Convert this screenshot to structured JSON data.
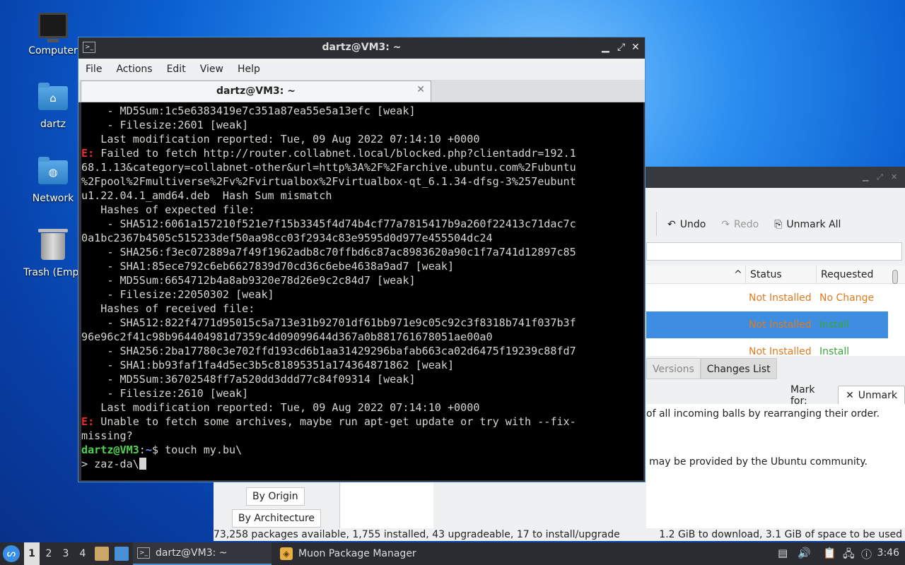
{
  "desktop": {
    "icons": [
      {
        "label": "Computer",
        "icon": "monitor-icon"
      },
      {
        "label": "dartz",
        "icon": "home-folder-icon"
      },
      {
        "label": "Network",
        "icon": "network-folder-icon"
      },
      {
        "label": "Trash (Empt",
        "icon": "trash-icon"
      }
    ]
  },
  "terminal": {
    "window_title": "dartz@VM3: ~",
    "menu": [
      "File",
      "Actions",
      "Edit",
      "View",
      "Help"
    ],
    "tab_label": "dartz@VM3: ~",
    "lines": [
      "    - MD5Sum:1c5e6383419e7c351a87ea55e5a13efc [weak]",
      "    - Filesize:2601 [weak]",
      "   Last modification reported: Tue, 09 Aug 2022 07:14:10 +0000",
      " Failed to fetch http://router.collabnet.local/blocked.php?clientaddr=192.1",
      "68.1.13&category=collabnet-other&url=http%3A%2F%2Farchive.ubuntu.com%2Fubuntu",
      "%2Fpool%2Fmultiverse%2Fv%2Fvirtualbox%2Fvirtualbox-qt_6.1.34-dfsg-3%257eubunt",
      "u1.22.04.1_amd64.deb  Hash Sum mismatch",
      "   Hashes of expected file:",
      "    - SHA512:6061a157210f521e7f15b3345f4d74b4cf77a7815417b9a260f22413c71dac7c",
      "0a1bc2367b4505c515233def50aa98cc03f2934c83e9595d0d977e455504dc24",
      "    - SHA256:f3ec072889a7f49f1962adb8c70ffbd6c87ac8983620a90c1f7a741d12897c85",
      "    - SHA1:85ece792c6eb6627839d70cd36c6ebe4638a9ad7 [weak]",
      "    - MD5Sum:6654712b4a8ab9320e78d26e9c2c84d7 [weak]",
      "    - Filesize:22050302 [weak]",
      "   Hashes of received file:",
      "    - SHA512:822f4771d95015c5a713e31b92701df61bb971e9c05c92c3f8318b741f037b3f",
      "96e96c2f41c98b964404981d7359c4d09099644d367a0b881761678051ae00a0",
      "    - SHA256:2ba17780c3e702ffd193cd6b1aa31429296bafab663ca02d6475f19239c88fd7",
      "    - SHA1:bb93faf1fa4d5ec3b5c81895351a174364871862 [weak]",
      "    - MD5Sum:36702548ff7a520dd3ddd77c84f09314 [weak]",
      "    - Filesize:2610 [weak]",
      "   Last modification reported: Tue, 09 Aug 2022 07:14:10 +0000",
      " Unable to fetch some archives, maybe run apt-get update or try with --fix-",
      "missing?"
    ],
    "error_prefix": "E:",
    "prompt_user": "dartz@VM3",
    "prompt_sep": ":",
    "prompt_path": "~",
    "prompt_dollar": "$",
    "command": " touch my.bu\\",
    "continuation": "> zaz-da\\"
  },
  "muon": {
    "toolbar": {
      "undo": "Undo",
      "redo": "Redo",
      "unmark_all": "Unmark All"
    },
    "columns": [
      "Status",
      "Requested"
    ],
    "rows": [
      {
        "status": "Not Installed",
        "requested": "No Change"
      },
      {
        "status": "Not Installed",
        "requested": "Install"
      },
      {
        "status": "Not Installed",
        "requested": "Install"
      }
    ],
    "tabs": [
      "Versions",
      "Changes List"
    ],
    "mark_for_label": "Mark for:",
    "unmark_button": "Unmark",
    "desc_line1": "of all incoming balls by rearranging their order.",
    "desc_line2": "may be provided by the Ubuntu community.",
    "filter_buttons": [
      "By Origin",
      "By Architecture"
    ],
    "status_left": "73,258 packages available, 1,755 installed, 43 upgradeable, 17 to install/upgrade",
    "status_right": "1.2 GiB to download, 3.1 GiB of space to be used"
  },
  "taskbar": {
    "workspaces": [
      "1",
      "2",
      "3",
      "4"
    ],
    "tasks": [
      {
        "label": "dartz@VM3: ~"
      },
      {
        "label": "Muon Package Manager"
      }
    ],
    "clock": "3:46"
  },
  "colors": {
    "error_red": "#ef2929",
    "prompt_green": "#4fd44f",
    "prompt_blue": "#6f8fff",
    "selection_blue": "#3d8ee0",
    "status_orange": "#e07b1e",
    "install_green": "#3aa53a"
  }
}
